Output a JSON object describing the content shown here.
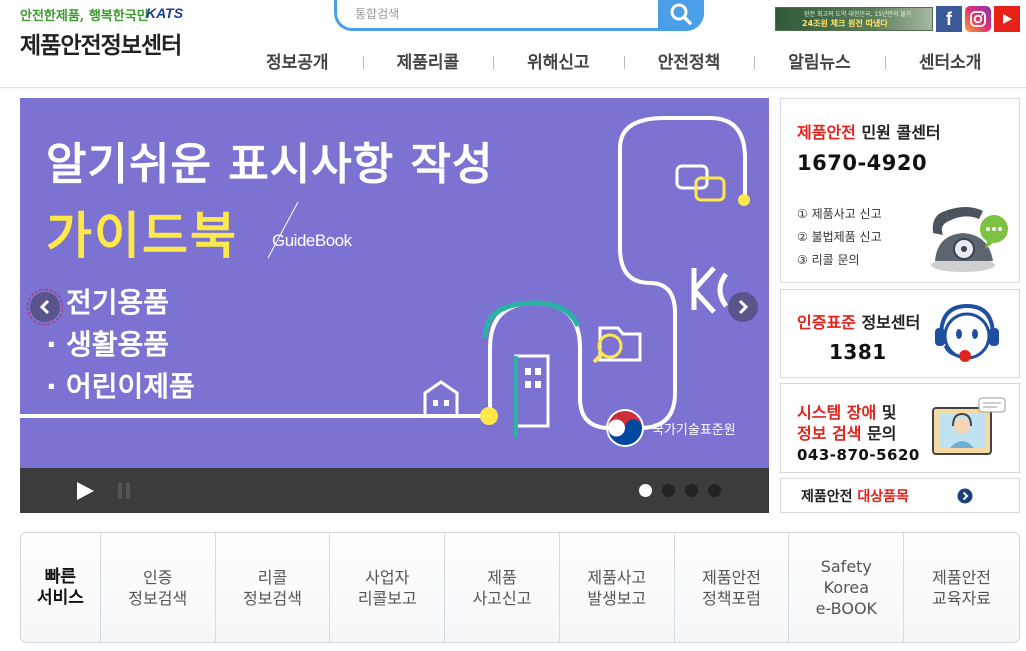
{
  "header": {
    "slogan": "안전한제품, 행복한국민",
    "slogan_mark": "KATS",
    "site_title": "제품안전정보센터",
    "search": {
      "placeholder": "통합검색"
    },
    "top_banner": {
      "line1": "완전 최고의 도약 대한민국, 15년만의 불가",
      "line2": "24조원 체크 원전 따냈다"
    },
    "sns": {
      "facebook": "f"
    }
  },
  "gnb": [
    "정보공개",
    "제품리콜",
    "위해신고",
    "안전정책",
    "알림뉴스",
    "센터소개"
  ],
  "hero": {
    "title_line1": "알기쉬운 표시사항 작성",
    "title_line2": "가이드북",
    "title_sub": "GuideBook",
    "items": [
      "전기용품",
      "생활용품",
      "어린이제품"
    ],
    "bullet": "·",
    "org": "국가기술표준원",
    "slide_count": 4,
    "active_slide": 1
  },
  "side": {
    "call_center": {
      "title_red": "제품안전",
      "title_rest": " 민원 콜센터",
      "number": "1670-4920",
      "lines": [
        "① 제품사고 신고",
        "② 불법제품 신고",
        "③ 리콜 문의"
      ]
    },
    "cert_center": {
      "title_red": "인증표준",
      "title_rest": " 정보센터",
      "number": "1381"
    },
    "system": {
      "line1_red": "시스템 장애",
      "line1_rest": " 및",
      "line2_red": "정보 검색",
      "line2_rest": " 문의",
      "number": "043-870-5620"
    },
    "target": {
      "title": "제품안전 ",
      "title_red": "대상품목"
    }
  },
  "quick": {
    "head": "빠른\n서비스",
    "items": [
      "인증\n정보검색",
      "리콜\n정보검색",
      "사업자\n리콜보고",
      "제품\n사고신고",
      "제품사고\n발생보고",
      "제품안전\n정책포럼",
      "Safety\nKorea\ne-BOOK",
      "제품안전\n교육자료"
    ]
  },
  "colors": {
    "hero_bg": "#7c72d2",
    "accent_blue": "#4a9fe8",
    "accent_red": "#e0231c",
    "title_yellow": "#ffe94a"
  }
}
